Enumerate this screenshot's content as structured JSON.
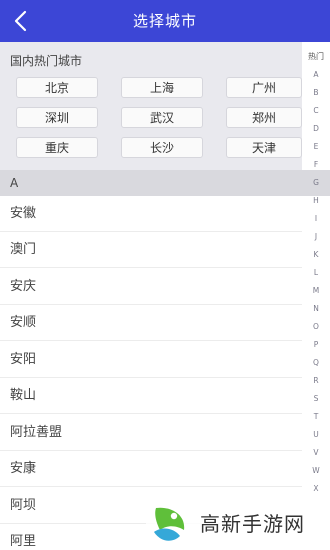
{
  "header": {
    "title": "选择城市",
    "back_icon": "chevron-left-icon",
    "background": "#3c46d6"
  },
  "hot": {
    "title": "国内热门城市",
    "cities": [
      "北京",
      "上海",
      "广州",
      "深圳",
      "武汉",
      "郑州",
      "重庆",
      "长沙",
      "天津"
    ]
  },
  "section": {
    "letter": "A"
  },
  "cities": [
    "安徽",
    "澳门",
    "安庆",
    "安顺",
    "安阳",
    "鞍山",
    "阿拉善盟",
    "安康",
    "阿坝",
    "阿里"
  ],
  "index": [
    "热门",
    "A",
    "B",
    "C",
    "D",
    "E",
    "F",
    "G",
    "H",
    "I",
    "J",
    "K",
    "L",
    "M",
    "N",
    "O",
    "P",
    "Q",
    "R",
    "S",
    "T",
    "U",
    "V",
    "W",
    "X"
  ],
  "watermark": {
    "text": "高新手游网",
    "logo_icon": "leaf-logo-icon"
  }
}
